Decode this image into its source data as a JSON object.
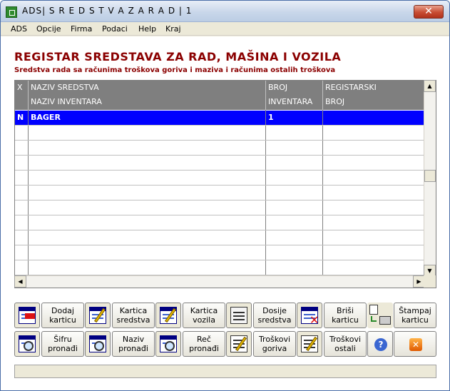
{
  "window": {
    "title": "ADS| S R E D S T V A  Z A  R A D  | 1",
    "close_glyph": "✕"
  },
  "menu": [
    "ADS",
    "Opcije",
    "Firma",
    "Podaci",
    "Help",
    "Kraj"
  ],
  "page": {
    "title": "REGISTAR SREDSTAVA ZA RAD, MAŠINA I VOZILA",
    "subtitle": "Sredstva rada sa računima troškova goriva i maziva i računima ostalih troškova"
  },
  "grid": {
    "headers": {
      "x": "X",
      "naziv_line1": "NAZIV SREDSTVA",
      "naziv_line2": "NAZIV INVENTARA",
      "broj_line1": "BROJ",
      "broj_line2": "INVENTARA",
      "reg_line1": "REGISTARSKI",
      "reg_line2": "BROJ"
    },
    "rows": [
      {
        "x": "N",
        "naziv": "BAGER",
        "broj": "1",
        "reg": ""
      }
    ]
  },
  "toolbar": {
    "row1": [
      {
        "icon": "add-card-icon",
        "label1": "Dodaj",
        "label2": "karticu"
      },
      {
        "icon": "edit-card-icon",
        "label1": "Kartica",
        "label2": "sredstva"
      },
      {
        "icon": "vehicle-card-icon",
        "label1": "Kartica",
        "label2": "vozila"
      },
      {
        "icon": "dossier-icon",
        "label1": "Dosije",
        "label2": "sredstva"
      },
      {
        "icon": "delete-card-icon",
        "label1": "Briši",
        "label2": "karticu"
      },
      {
        "icon": "print-icon",
        "label1": "Štampaj",
        "label2": "karticu"
      }
    ],
    "row2": [
      {
        "icon": "find-code-icon",
        "label1": "Šifru",
        "label2": "pronađi"
      },
      {
        "icon": "find-name-icon",
        "label1": "Naziv",
        "label2": "pronađi"
      },
      {
        "icon": "find-word-icon",
        "label1": "Reč",
        "label2": "pronađi"
      },
      {
        "icon": "fuel-costs-icon",
        "label1": "Troškovi",
        "label2": "goriva"
      },
      {
        "icon": "other-costs-icon",
        "label1": "Troškovi",
        "label2": "ostali"
      }
    ],
    "help_glyph": "?",
    "exit_glyph": "✕"
  },
  "colors": {
    "title": "#8b0000",
    "selection": "#0000ff",
    "header": "#7f7f7f"
  }
}
